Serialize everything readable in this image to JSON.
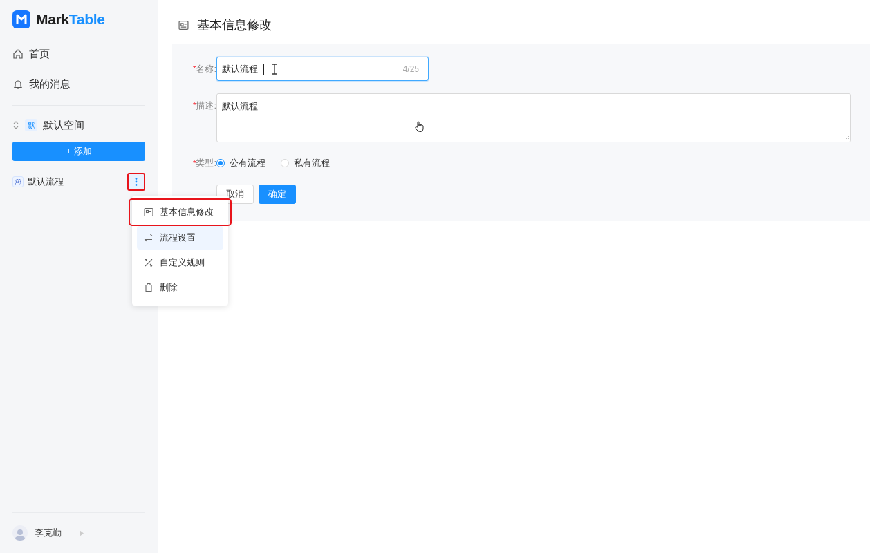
{
  "sidebar": {
    "brand": {
      "dark": "Mark",
      "accent": "Table"
    },
    "nav": [
      {
        "label": "首页"
      },
      {
        "label": "我的消息"
      }
    ],
    "space": {
      "badge": "默",
      "name": "默认空间"
    },
    "add_button": {
      "label": "+ 添加"
    },
    "flows": [
      {
        "label": "默认流程",
        "more_highlighted": true
      }
    ],
    "user": {
      "name": "李克勤"
    }
  },
  "context_menu": [
    {
      "label": "基本信息修改",
      "hovered": false,
      "highlighted": true
    },
    {
      "label": "流程设置",
      "hovered": true,
      "highlighted": false
    },
    {
      "label": "自定义规则",
      "hovered": false,
      "highlighted": false
    },
    {
      "label": "删除",
      "hovered": false,
      "highlighted": false
    }
  ],
  "page": {
    "title": "基本信息修改",
    "fields": [
      {
        "kind": "input",
        "required_mark": "*",
        "label": "名称:",
        "value": "默认流程",
        "counter": "4/25",
        "focused": true
      },
      {
        "kind": "textarea",
        "required_mark": "*",
        "label": "描述:",
        "value": "默认流程",
        "focused": false
      },
      {
        "kind": "radio",
        "required_mark": "*",
        "label": "类型:",
        "options": [
          {
            "label": "公有流程",
            "selected": true
          },
          {
            "label": "私有流程",
            "selected": false
          }
        ]
      }
    ],
    "buttons": [
      {
        "kind": "default",
        "label": "取消"
      },
      {
        "kind": "primary",
        "label": "确定"
      }
    ]
  }
}
